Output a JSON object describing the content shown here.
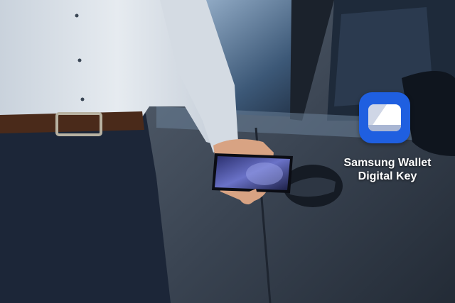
{
  "overlay": {
    "icon": "samsung-wallet-icon",
    "title_line1": "Samsung Wallet",
    "title_line2": "Digital Key"
  },
  "colors": {
    "icon_blue": "#1f5fe0",
    "car_body": "#3a4452",
    "shirt": "#dde3ea",
    "jeans": "#1c2638"
  }
}
